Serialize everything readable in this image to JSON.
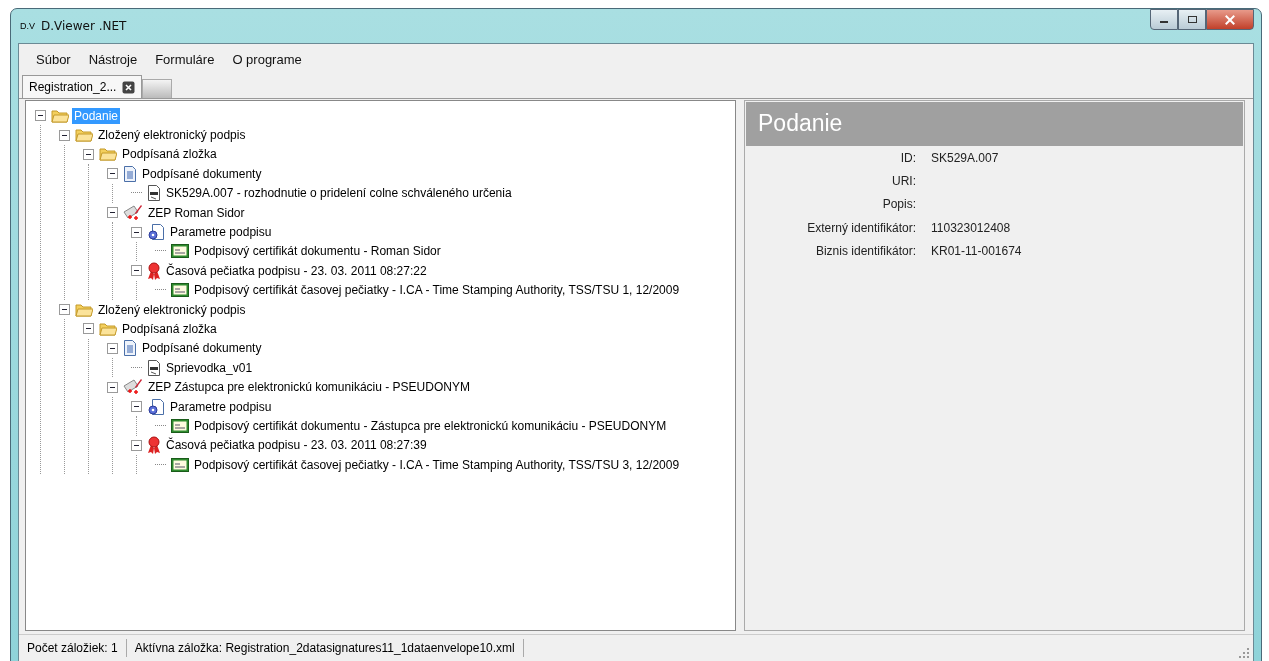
{
  "window": {
    "app_icon_text": "D.V",
    "title": "D.Viewer .NET"
  },
  "menu": [
    "Súbor",
    "Nástroje",
    "Formuláre",
    "O programe"
  ],
  "tabs": [
    {
      "label": "Registration_2...",
      "selected": true
    }
  ],
  "tree": [
    {
      "label": "Podanie",
      "kind": "folder",
      "selected": true,
      "expanded": true,
      "children": [
        {
          "label": "Zložený elektronický podpis",
          "kind": "folder",
          "selected": false,
          "expanded": true,
          "children": [
            {
              "label": "Podpísaná zložka",
              "kind": "folder",
              "selected": false,
              "expanded": true,
              "children": [
                {
                  "label": "Podpísané dokumenty",
                  "kind": "document",
                  "selected": false,
                  "expanded": true,
                  "children": [
                    {
                      "label": "SK529A.007 - rozhodnutie o pridelení colne schváleného určenia",
                      "kind": "xml",
                      "selected": false
                    }
                  ]
                },
                {
                  "label": "ZEP Roman Sidor",
                  "kind": "signature",
                  "selected": false,
                  "expanded": true,
                  "children": [
                    {
                      "label": "Parametre podpisu",
                      "kind": "params",
                      "selected": false,
                      "expanded": true,
                      "children": [
                        {
                          "label": "Podpisový certifikát dokumentu - Roman Sidor",
                          "kind": "certificate",
                          "selected": false
                        }
                      ]
                    },
                    {
                      "label": "Časová pečiatka podpisu - 23. 03. 2011 08:27:22",
                      "kind": "seal",
                      "selected": false,
                      "expanded": true,
                      "children": [
                        {
                          "label": "Podpisový certifikát časovej pečiatky - I.CA - Time Stamping Authority, TSS/TSU 1, 12/2009",
                          "kind": "certificate",
                          "selected": false
                        }
                      ]
                    }
                  ]
                }
              ]
            }
          ]
        },
        {
          "label": "Zložený elektronický podpis",
          "kind": "folder",
          "selected": false,
          "expanded": true,
          "children": [
            {
              "label": "Podpísaná zložka",
              "kind": "folder",
              "selected": false,
              "expanded": true,
              "children": [
                {
                  "label": "Podpísané dokumenty",
                  "kind": "document",
                  "selected": false,
                  "expanded": true,
                  "children": [
                    {
                      "label": "Sprievodka_v01",
                      "kind": "xml",
                      "selected": false
                    }
                  ]
                },
                {
                  "label": "ZEP Zástupca pre elektronickú komunikáciu - PSEUDONYM",
                  "kind": "signature",
                  "selected": false,
                  "expanded": true,
                  "children": [
                    {
                      "label": "Parametre podpisu",
                      "kind": "params",
                      "selected": false,
                      "expanded": true,
                      "children": [
                        {
                          "label": "Podpisový certifikát dokumentu - Zástupca pre elektronickú komunikáciu - PSEUDONYM",
                          "kind": "certificate",
                          "selected": false
                        }
                      ]
                    },
                    {
                      "label": "Časová pečiatka podpisu - 23. 03. 2011 08:27:39",
                      "kind": "seal",
                      "selected": false,
                      "expanded": true,
                      "children": [
                        {
                          "label": "Podpisový certifikát časovej pečiatky - I.CA - Time Stamping Authority, TSS/TSU 3, 12/2009",
                          "kind": "certificate",
                          "selected": false
                        }
                      ]
                    }
                  ]
                }
              ]
            }
          ]
        }
      ]
    }
  ],
  "details": {
    "title": "Podanie",
    "fields": [
      {
        "label": "ID:",
        "value": "SK529A.007"
      },
      {
        "label": "URI:"
      },
      {
        "label": "Popis:"
      },
      {
        "label": "Externý identifikátor:",
        "value": "110323012408"
      },
      {
        "label": "Biznis identifikátor:",
        "value": "KR01-11-001674"
      }
    ]
  },
  "status_bar": [
    "Počet záložiek: 1",
    "Aktívna záložka: Registration_2datasignatures11_1dataenvelope10.xml"
  ]
}
